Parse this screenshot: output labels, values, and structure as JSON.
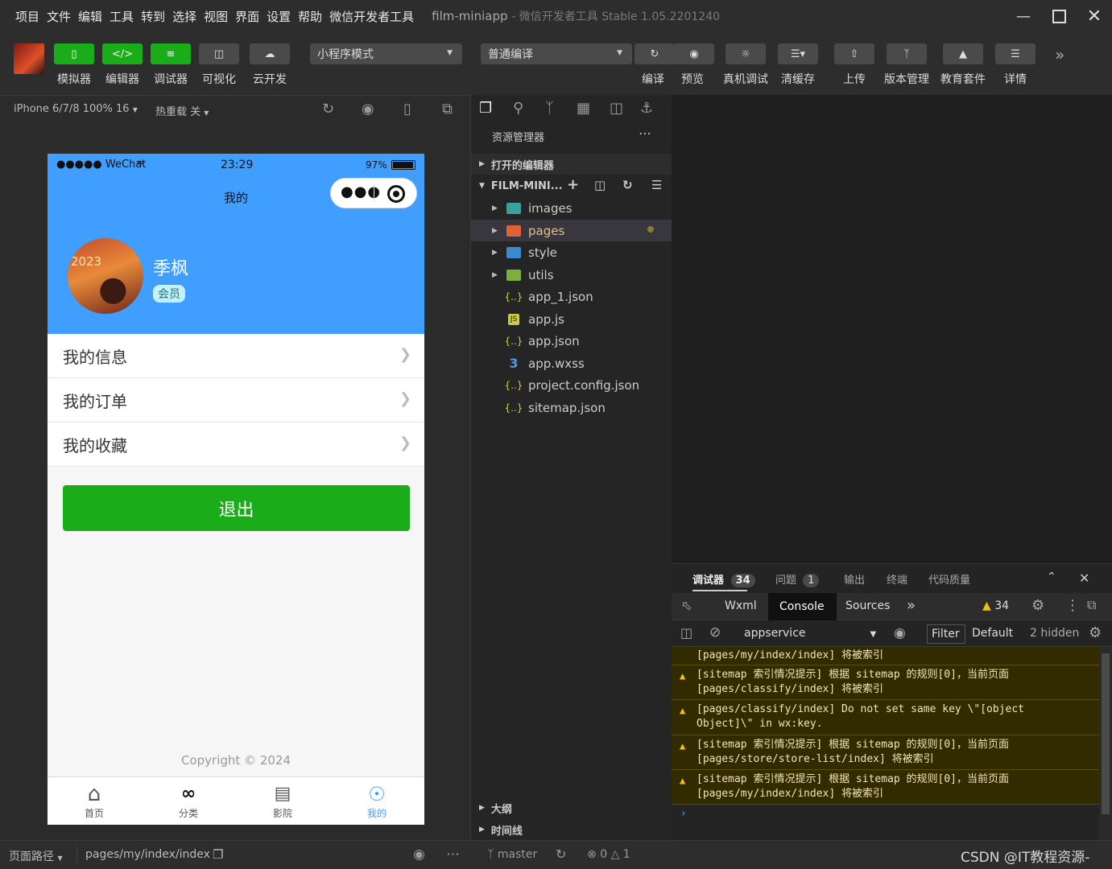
{
  "menubar": {
    "items": [
      "项目",
      "文件",
      "编辑",
      "工具",
      "转到",
      "选择",
      "视图",
      "界面",
      "设置",
      "帮助",
      "微信开发者工具"
    ],
    "title": "film-miniapp",
    "subtitle": "- 微信开发者工具 Stable 1.05.2201240"
  },
  "toolbar": {
    "simulator": "模拟器",
    "editor": "编辑器",
    "debugger": "调试器",
    "visual": "可视化",
    "cloud": "云开发",
    "mode": "小程序模式",
    "compile_mode": "普通编译",
    "compile": "编译",
    "preview": "预览",
    "real_debug": "真机调试",
    "clear_cache": "清缓存",
    "upload": "上传",
    "version": "版本管理",
    "education": "教育套件",
    "details": "详情"
  },
  "simbar": {
    "device": "iPhone 6/7/8 100% 16",
    "hot_reload": "热重载 关"
  },
  "phone": {
    "carrier": "●●●●● WeChat",
    "time": "23:29",
    "battery": "97%",
    "nav_title": "我的",
    "avatar_text": "2023",
    "username": "季枫",
    "badge": "会员",
    "menu": [
      "我的信息",
      "我的订单",
      "我的收藏"
    ],
    "logout": "退出",
    "copyright": "Copyright © 2024",
    "tabs": [
      {
        "label": "首页",
        "icon": "home-icon"
      },
      {
        "label": "分类",
        "icon": "category-icon"
      },
      {
        "label": "影院",
        "icon": "store-icon"
      },
      {
        "label": "我的",
        "icon": "user-icon"
      }
    ],
    "active_tab": "我的",
    "accent": "#409eff",
    "button_green": "#1aad19"
  },
  "explorer": {
    "title": "资源管理器",
    "open_editors": "打开的编辑器",
    "project": "FILM-MINI...",
    "folders": [
      "images",
      "pages",
      "style",
      "utils"
    ],
    "files": [
      {
        "name": "app_1.json",
        "icon": "json-icon"
      },
      {
        "name": "app.js",
        "icon": "js-icon"
      },
      {
        "name": "app.json",
        "icon": "json-icon"
      },
      {
        "name": "app.wxss",
        "icon": "css-icon"
      },
      {
        "name": "project.config.json",
        "icon": "json-icon"
      },
      {
        "name": "sitemap.json",
        "icon": "json-icon"
      }
    ],
    "outline": "大纲",
    "timeline": "时间线"
  },
  "devtools": {
    "tabs": [
      {
        "label": "调试器",
        "count": "34"
      },
      {
        "label": "问题",
        "count": "1"
      },
      {
        "label": "输出"
      },
      {
        "label": "终端"
      },
      {
        "label": "代码质量"
      }
    ],
    "subtabs": [
      "Wxml",
      "Console",
      "Sources"
    ],
    "active_subtab": "Console",
    "warn_count": "34",
    "context": "appservice",
    "filter": "Filter",
    "level": "Default",
    "hidden": "2 hidden",
    "logs": [
      [
        "",
        "[pages/my/index/index] 将被索引"
      ],
      [
        "[sitemap 索引情况提示] 根据 sitemap 的规则[0]，当前页面",
        "[pages/classify/index] 将被索引"
      ],
      [
        "[pages/classify/index] Do not set same key \\\"[object",
        "Object]\\\" in wx:key."
      ],
      [
        "[sitemap 索引情况提示] 根据 sitemap 的规则[0]，当前页面",
        "[pages/store/store-list/index] 将被索引"
      ],
      [
        "[sitemap 索引情况提示] 根据 sitemap 的规则[0]，当前页面",
        "[pages/my/index/index] 将被索引"
      ]
    ]
  },
  "bottombar": {
    "path_label": "页面路径",
    "path": "pages/my/index/index",
    "branch": "master",
    "errors": "0",
    "warnings": "1",
    "watermark": "CSDN @IT教程资源-"
  }
}
